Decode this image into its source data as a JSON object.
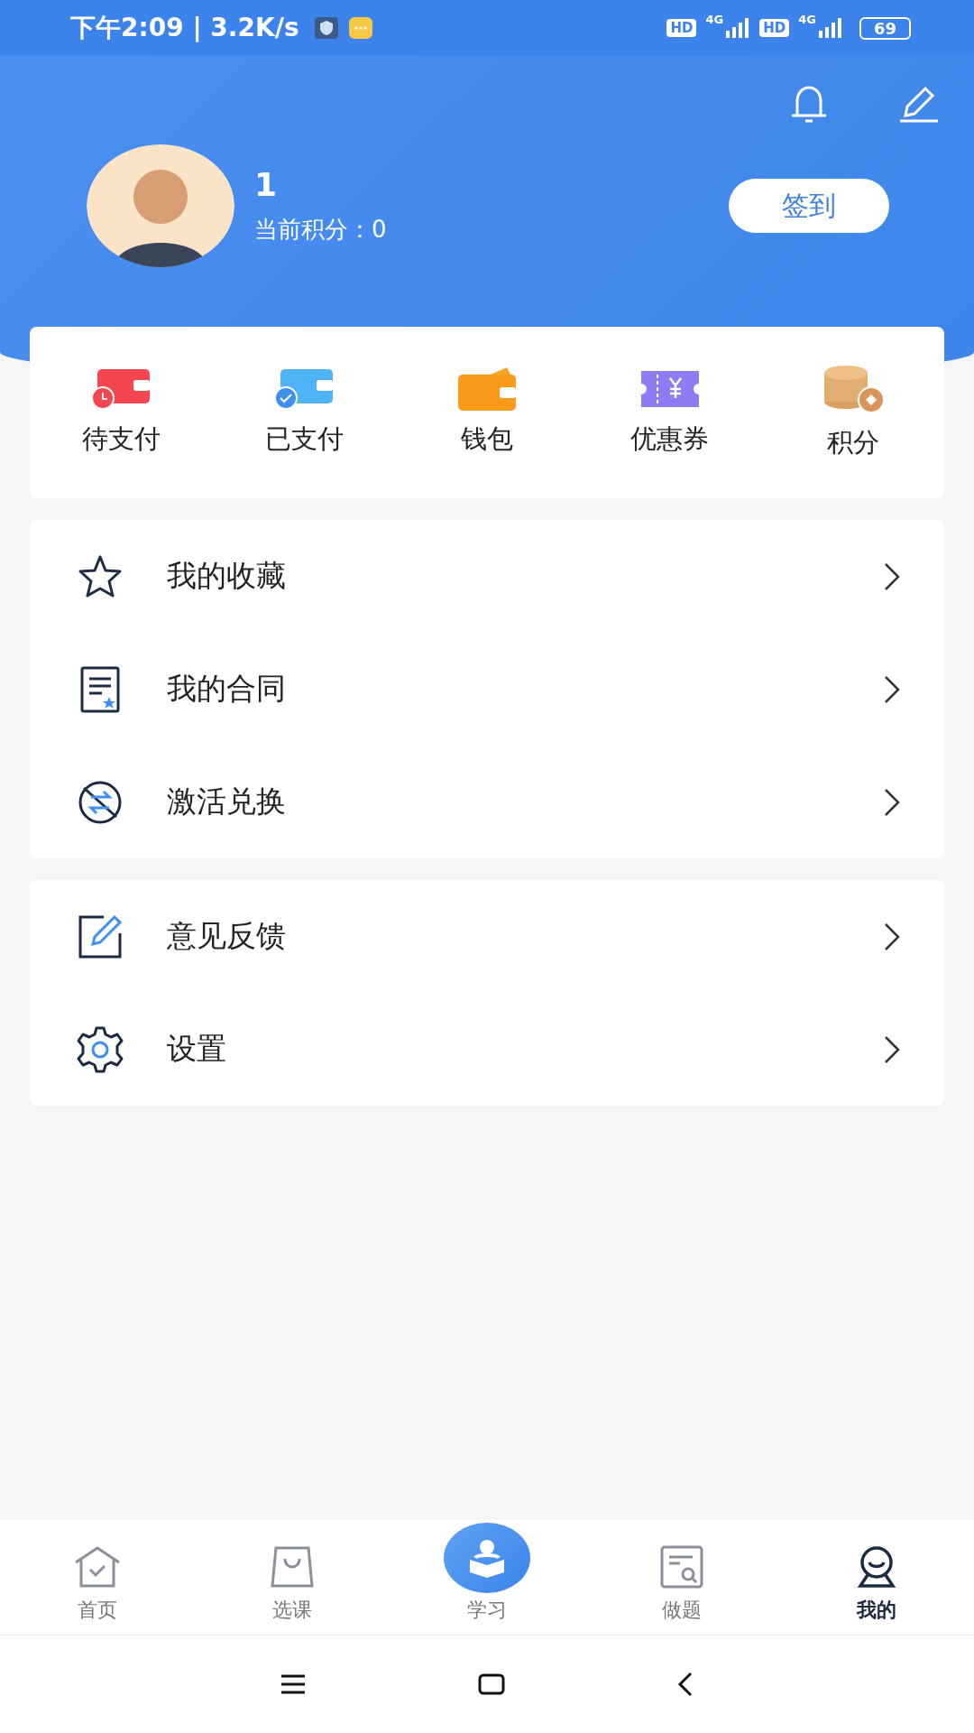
{
  "status_bar": {
    "time_speed": "下午2:09 | 3.2K/s",
    "sim1_hd": "HD",
    "sim1_net": "4G",
    "sim2_hd": "HD",
    "sim2_net": "4G",
    "battery": "69"
  },
  "profile": {
    "name": "1",
    "points": "当前积分：0",
    "checkin_button": "签到"
  },
  "quick_actions": [
    {
      "kind": "pending",
      "label": "待支付"
    },
    {
      "kind": "paid",
      "label": "已支付"
    },
    {
      "kind": "wallet",
      "label": "钱包"
    },
    {
      "kind": "coupon",
      "label": "优惠券"
    },
    {
      "kind": "points",
      "label": "积分"
    }
  ],
  "menu_groups": [
    [
      {
        "kind": "favorites",
        "label": "我的收藏"
      },
      {
        "kind": "contract",
        "label": "我的合同"
      },
      {
        "kind": "redeem",
        "label": "激活兑换"
      }
    ],
    [
      {
        "kind": "feedback",
        "label": "意见反馈"
      },
      {
        "kind": "settings",
        "label": "设置"
      }
    ]
  ],
  "tab_bar": [
    {
      "kind": "home",
      "label": "首页",
      "selected": false
    },
    {
      "kind": "courses",
      "label": "选课",
      "selected": false
    },
    {
      "kind": "study",
      "label": "学习",
      "selected": false
    },
    {
      "kind": "practice",
      "label": "做题",
      "selected": false
    },
    {
      "kind": "mine",
      "label": "我的",
      "selected": true
    }
  ]
}
